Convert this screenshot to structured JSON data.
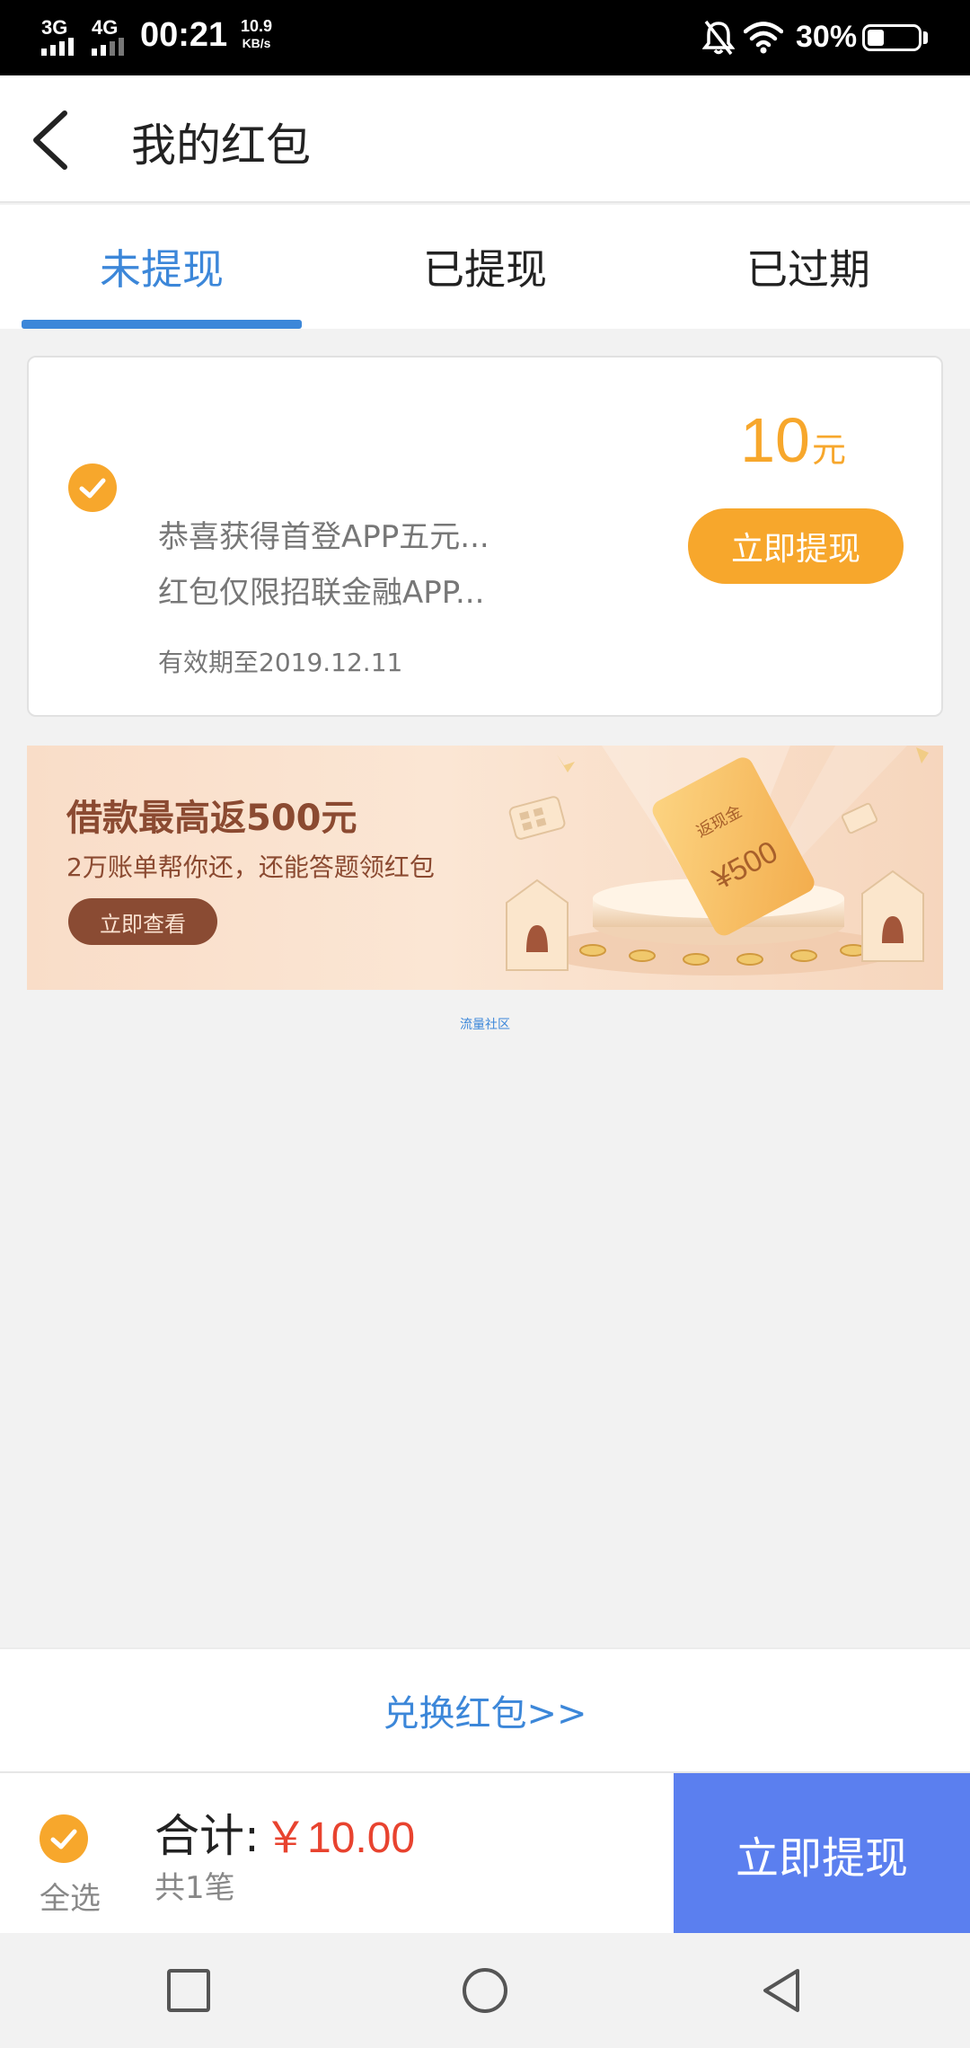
{
  "status_bar": {
    "net1": "3G",
    "net2": "4G",
    "time": "00:21",
    "speed_value": "10.9",
    "speed_unit": "KB/s",
    "battery": "30%",
    "battery_level": 0.3
  },
  "header": {
    "title": "我的红包"
  },
  "tabs": [
    {
      "label": "未提现",
      "active": true
    },
    {
      "label": "已提现",
      "active": false
    },
    {
      "label": "已过期",
      "active": false
    }
  ],
  "packet": {
    "amount": "10",
    "unit": "元",
    "desc1": "恭喜获得首登APP五元...",
    "desc2": "红包仅限招联金融APP...",
    "expiry": "有效期至2019.12.11",
    "button": "立即提现",
    "selected": true
  },
  "banner": {
    "title": "借款最高返500元",
    "subtitle": "2万账单帮你还，还能答题领红包",
    "button": "立即查看",
    "card_text1": "返现金",
    "card_text2": "¥500"
  },
  "footer_link": "流量社区",
  "exchange_link": "兑换红包>>",
  "bottom_bar": {
    "select_all": "全选",
    "total_label": "合计:",
    "total_value": "￥10.00",
    "count": "共1笔",
    "withdraw_button": "立即提现"
  },
  "colors": {
    "accent_blue": "#3c87d9",
    "orange": "#f7a72c",
    "price_red": "#e8432f",
    "button_blue": "#5b7fef"
  }
}
